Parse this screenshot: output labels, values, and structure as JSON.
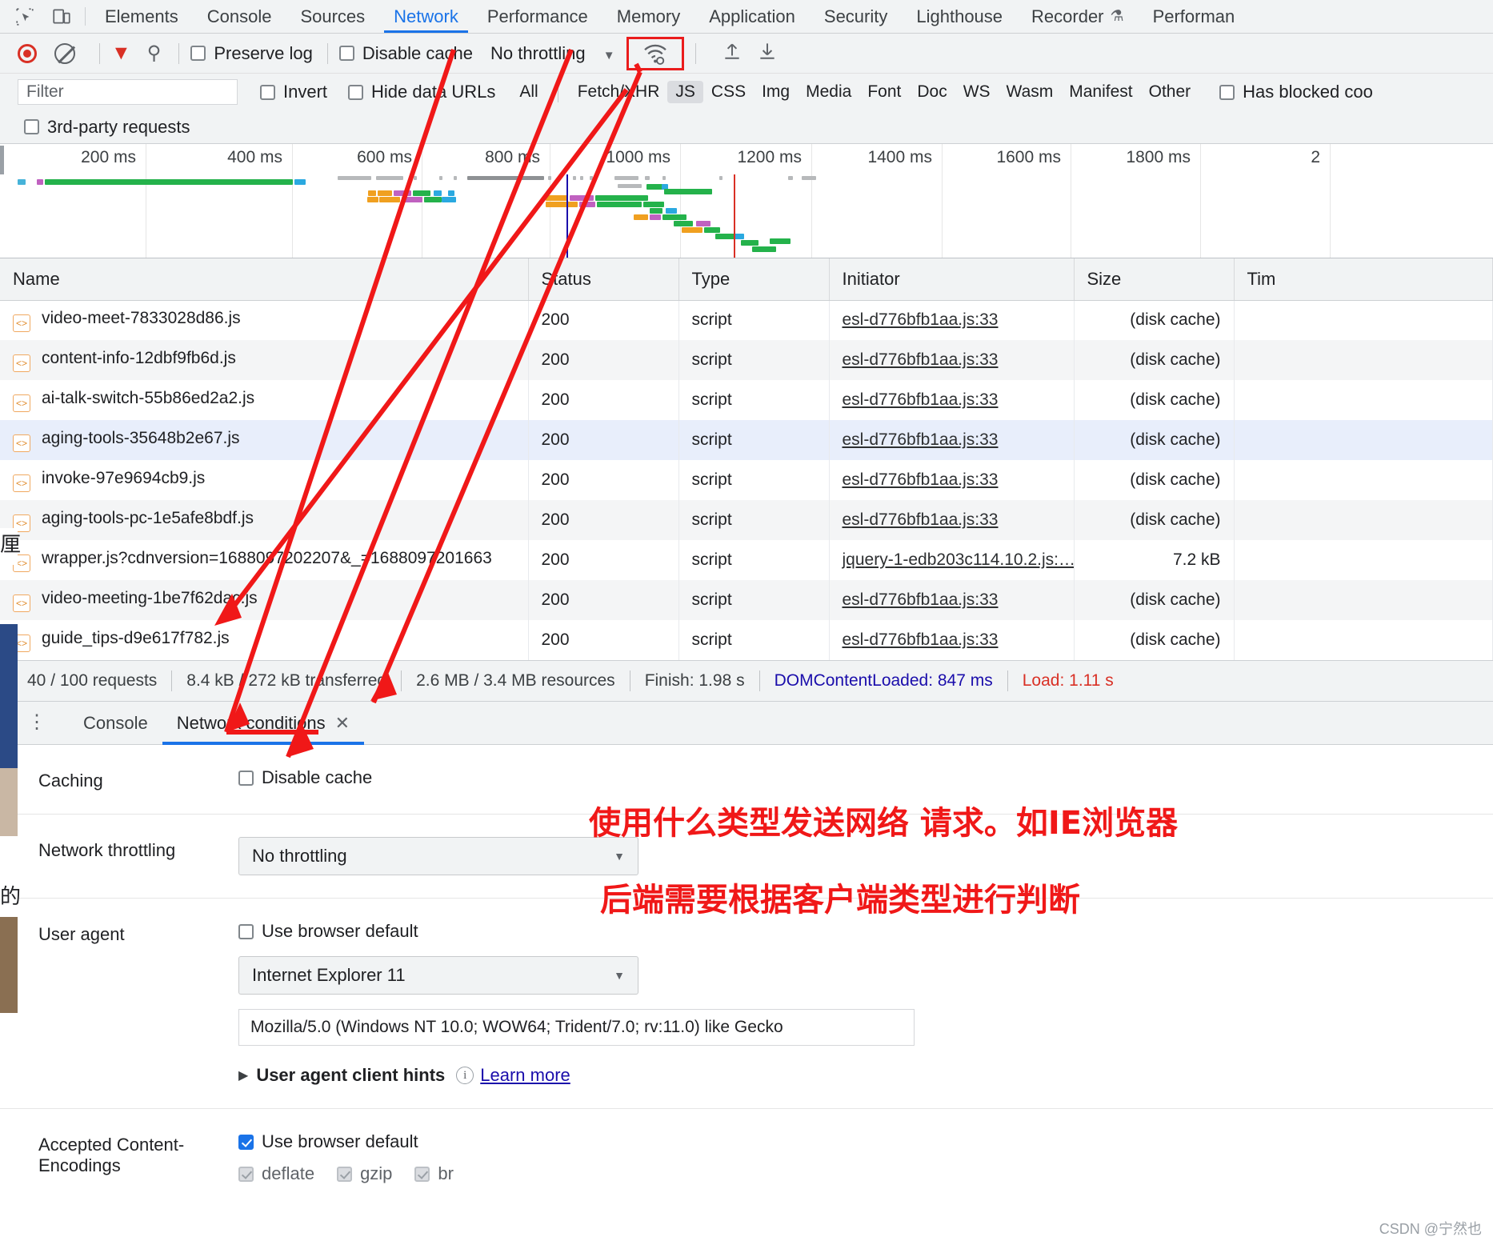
{
  "devtools_tabs": [
    {
      "label": "Elements",
      "active": false
    },
    {
      "label": "Console",
      "active": false
    },
    {
      "label": "Sources",
      "active": false
    },
    {
      "label": "Network",
      "active": true
    },
    {
      "label": "Performance",
      "active": false
    },
    {
      "label": "Memory",
      "active": false
    },
    {
      "label": "Application",
      "active": false
    },
    {
      "label": "Security",
      "active": false
    },
    {
      "label": "Lighthouse",
      "active": false
    },
    {
      "label": "Recorder",
      "active": false
    },
    {
      "label": "Performan",
      "active": false
    }
  ],
  "toolbar": {
    "preserve_log": "Preserve log",
    "preserve_log_checked": false,
    "disable_cache": "Disable cache",
    "disable_cache_checked": false,
    "throttle_value": "No throttling",
    "wifi_icon": "network-conditions-icon",
    "import_icon": "import-har-icon",
    "export_icon": "export-har-icon"
  },
  "filter_bar": {
    "placeholder": "Filter",
    "value": "",
    "invert": "Invert",
    "invert_checked": false,
    "hide_data_urls": "Hide data URLs",
    "hide_data_urls_checked": false,
    "types": [
      "All",
      "Fetch/XHR",
      "JS",
      "CSS",
      "Img",
      "Media",
      "Font",
      "Doc",
      "WS",
      "Wasm",
      "Manifest",
      "Other"
    ],
    "selected_type": "JS",
    "has_blocked_cookies": "Has blocked coo",
    "has_blocked_checked": false,
    "third_party": "3rd-party requests",
    "third_party_checked": false
  },
  "overview": {
    "ticks": [
      "200 ms",
      "400 ms",
      "600 ms",
      "800 ms",
      "1000 ms",
      "1200 ms",
      "1400 ms",
      "1600 ms",
      "1800 ms",
      "2"
    ],
    "dcl_color": "#1a0dab",
    "load_color": "#d93025"
  },
  "table": {
    "columns": [
      "Name",
      "Status",
      "Type",
      "Initiator",
      "Size",
      "Tim"
    ],
    "rows": [
      {
        "name": "video-meet-7833028d86.js",
        "status": "200",
        "type": "script",
        "initiator": "esl-d776bfb1aa.js:33",
        "size": "(disk cache)",
        "selected": false
      },
      {
        "name": "content-info-12dbf9fb6d.js",
        "status": "200",
        "type": "script",
        "initiator": "esl-d776bfb1aa.js:33",
        "size": "(disk cache)",
        "selected": false
      },
      {
        "name": "ai-talk-switch-55b86ed2a2.js",
        "status": "200",
        "type": "script",
        "initiator": "esl-d776bfb1aa.js:33",
        "size": "(disk cache)",
        "selected": false
      },
      {
        "name": "aging-tools-35648b2e67.js",
        "status": "200",
        "type": "script",
        "initiator": "esl-d776bfb1aa.js:33",
        "size": "(disk cache)",
        "selected": true
      },
      {
        "name": "invoke-97e9694cb9.js",
        "status": "200",
        "type": "script",
        "initiator": "esl-d776bfb1aa.js:33",
        "size": "(disk cache)",
        "selected": false
      },
      {
        "name": "aging-tools-pc-1e5afe8bdf.js",
        "status": "200",
        "type": "script",
        "initiator": "esl-d776bfb1aa.js:33",
        "size": "(disk cache)",
        "selected": false
      },
      {
        "name": "wrapper.js?cdnversion=168809720220​7&_=1688097201663",
        "status": "200",
        "type": "script",
        "initiator": "jquery-1-edb203c114.10.2.js:…",
        "size": "7.2 kB",
        "selected": false
      },
      {
        "name": "video-meeting-1be7f62dac.js",
        "status": "200",
        "type": "script",
        "initiator": "esl-d776bfb1aa.js:33",
        "size": "(disk cache)",
        "selected": false
      },
      {
        "name": "guide_tips-d9e617f782.js",
        "status": "200",
        "type": "script",
        "initiator": "esl-d776bfb1aa.js:33",
        "size": "(disk cache)",
        "selected": false
      }
    ]
  },
  "summary": {
    "requests": "40 / 100 requests",
    "transferred": "8.4 kB / 272 kB transferred",
    "resources": "2.6 MB / 3.4 MB resources",
    "finish": "Finish: 1.98 s",
    "dom_content_loaded": "DOMContentLoaded: 847 ms",
    "load": "Load: 1.11 s"
  },
  "drawer": {
    "kebab": "more-tools-icon",
    "tabs": [
      {
        "label": "Console",
        "active": false,
        "closable": false
      },
      {
        "label": "Network conditions",
        "active": true,
        "closable": true
      }
    ]
  },
  "network_conditions": {
    "caching_label": "Caching",
    "disable_cache_label": "Disable cache",
    "disable_cache_checked": false,
    "throttling_label": "Network throttling",
    "throttling_value": "No throttling",
    "user_agent_label": "User agent",
    "use_browser_default_label": "Use browser default",
    "use_browser_default_checked": false,
    "ua_select_value": "Internet Explorer 11",
    "ua_string": "Mozilla/5.0 (Windows NT 10.0; WOW64; Trident/7.0; rv:11.0) like Gecko",
    "client_hints_label": "User agent client hints",
    "learn_more": "Learn more",
    "encodings_label": "Accepted Content-Encodings",
    "encodings_browser_default": "Use browser default",
    "encodings_browser_default_checked": true,
    "encodings": [
      {
        "label": "deflate",
        "checked": true
      },
      {
        "label": "gzip",
        "checked": true
      },
      {
        "label": "br",
        "checked": true
      }
    ]
  },
  "annotations": {
    "note1": "使用什么类型发送网络 请求。如IE浏览器",
    "note2": "后端需要根据客户端类型进行判断",
    "watermark": "CSDN @宁然也",
    "arrow_color": "#f01818"
  },
  "page_fragments": {
    "char1": "厘",
    "char2": "的"
  }
}
